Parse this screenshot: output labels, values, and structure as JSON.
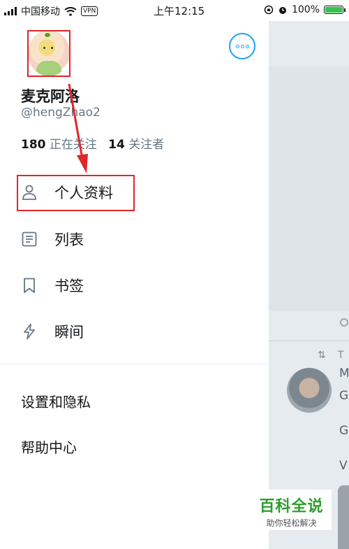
{
  "status_bar": {
    "carrier": "中国移动",
    "vpn": "VPN",
    "time": "上午12:15",
    "battery": "100%"
  },
  "profile": {
    "display_name": "麦克阿洛",
    "handle": "@hengZhao2",
    "following_count": "180",
    "following_label": "正在关注",
    "followers_count": "14",
    "followers_label": "关注者"
  },
  "menu": {
    "items": [
      {
        "label": "个人资料",
        "icon": "person-icon"
      },
      {
        "label": "列表",
        "icon": "list-icon"
      },
      {
        "label": "书签",
        "icon": "bookmark-icon"
      },
      {
        "label": "瞬间",
        "icon": "lightning-icon"
      }
    ],
    "settings": "设置和隐私",
    "help": "帮助中心"
  },
  "background": {
    "chars": [
      "T",
      "M",
      "G",
      "G",
      "V"
    ]
  },
  "watermark": {
    "title": "百科全说",
    "subtitle": "助你轻松解决"
  },
  "colors": {
    "accent": "#1da1f2",
    "annotation": "#e0262a",
    "watermark_green": "#2e9e2e"
  }
}
